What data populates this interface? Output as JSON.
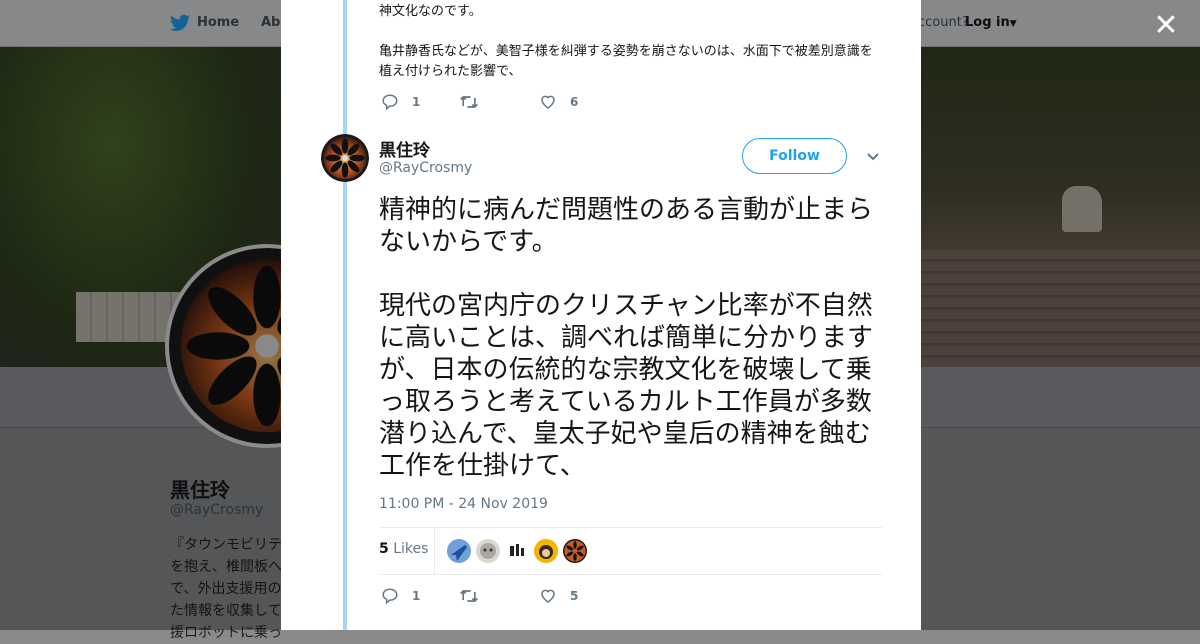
{
  "nav": {
    "home_label": "Home",
    "about_label": "Abo",
    "account_text": "ccount?",
    "login_label": "Log in"
  },
  "profile": {
    "name": "黒住玲",
    "handle": "@RayCrosmy",
    "bio_lines": [
      "『タウンモビリテ",
      "を抱え、椎間板へ",
      "で、外出支援用の",
      "た情報を収集して",
      "援ロボットに乗っ"
    ]
  },
  "previous_tweet": {
    "text": "神文化なのです。\n\n亀井静香氏などが、美智子様を糾弾する姿勢を崩さないのは、水面下で被差別意識を植え付けられた影響で、",
    "reply_count": "1",
    "retweet_count": "",
    "like_count": "6"
  },
  "tweet": {
    "author_name": "黒住玲",
    "author_handle": "@RayCrosmy",
    "follow_label": "Follow",
    "text": "精神的に病んだ問題性のある言動が止まらないからです。\n\n現代の宮内庁のクリスチャン比率が不自然に高いことは、調べれば簡単に分かりますが、日本の伝統的な宗教文化を破壊して乗っ取ろうと考えているカルト工作員が多数潜り込んで、皇太子妃や皇后の精神を蝕む工作を仕掛けて、",
    "timestamp": "11:00 PM - 24 Nov 2019",
    "likes_number": "5",
    "likes_word": "Likes",
    "reply_count": "1",
    "retweet_count": "",
    "like_count": "5"
  },
  "colors": {
    "accent": "#1da1f2",
    "thread_line": "#a5d6f6",
    "muted": "#657786"
  }
}
